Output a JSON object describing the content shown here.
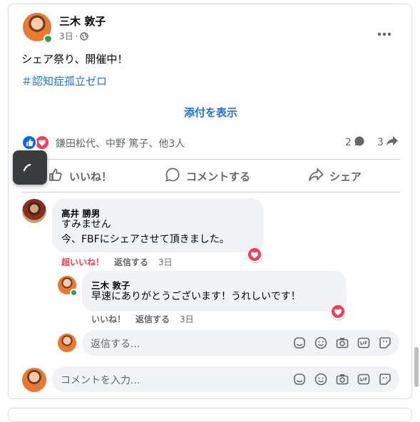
{
  "post": {
    "author": "三木 敦子",
    "time": "3日",
    "separator": "·",
    "text": "シェア祭り、開催中！",
    "hashtag": "＃認知症孤立ゼロ",
    "show_attachment": "添付を表示",
    "reactions_summary": "鎌田松代、中野 篤子、他3人",
    "comment_count": "2",
    "share_count": "3",
    "actions": {
      "like": "いいね！",
      "comment": "コメントする",
      "share": "シェア"
    }
  },
  "comments": [
    {
      "author": "高井 勝男",
      "lines": [
        "すみません",
        "今、FBFにシェアさせて頂きました。"
      ],
      "reaction_label": "超いいね！",
      "reply_label": "返信する",
      "time": "3日",
      "replies": [
        {
          "author": "三木 敦子",
          "text": "早速にありがとうございます！うれしいです！",
          "like_label": "いいね！",
          "reply_label": "返信する",
          "time": "3日"
        }
      ]
    }
  ],
  "reply_input": {
    "placeholder": "返信する..."
  },
  "comment_input": {
    "placeholder": "コメントを入力..."
  },
  "colors": {
    "brand_blue": "#0866ff",
    "link_blue": "#216fdb",
    "love_red": "#f33e58",
    "online_green": "#31a24c",
    "secondary_text": "#65676b"
  },
  "icons": [
    "globe-icon",
    "more-icon",
    "like-reaction-icon",
    "love-reaction-icon",
    "comment-count-icon",
    "share-count-icon",
    "thumb-up-icon",
    "comment-icon",
    "share-icon",
    "sticker-icon",
    "emoji-icon",
    "camera-icon",
    "gif-icon",
    "avatar-sticker-icon",
    "loading-spinner-icon"
  ]
}
